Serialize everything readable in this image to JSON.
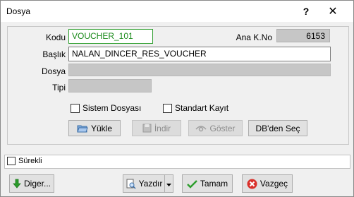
{
  "window": {
    "title": "Dosya",
    "help": "?",
    "close": "✕"
  },
  "form": {
    "kodu_label": "Kodu",
    "kodu_value": "VOUCHER_101",
    "ana_kno_label": "Ana K.No",
    "ana_kno_value": "6153",
    "baslik_label": "Başlık",
    "baslik_value": "NALAN_DINCER_RES_VOUCHER",
    "dosya_label": "Dosya",
    "dosya_value": "",
    "tipi_label": "Tipi",
    "tipi_value": ""
  },
  "checkboxes": {
    "sistem_dosyasi": "Sistem Dosyası",
    "standart_kayit": "Standart Kayıt"
  },
  "buttons": {
    "yukle": "Yükle",
    "indir": "İndir",
    "goster": "Göster",
    "dbden_sec": "DB'den Seç"
  },
  "status": {
    "surekli": "Sürekli"
  },
  "footer": {
    "diger": "Diger...",
    "yazdir": "Yazdır",
    "tamam": "Tamam",
    "vazgec": "Vazgeç"
  },
  "colors": {
    "ok_green": "#2e9e2e",
    "cancel_red": "#d9302a",
    "arrow_green": "#2a9a2a"
  }
}
